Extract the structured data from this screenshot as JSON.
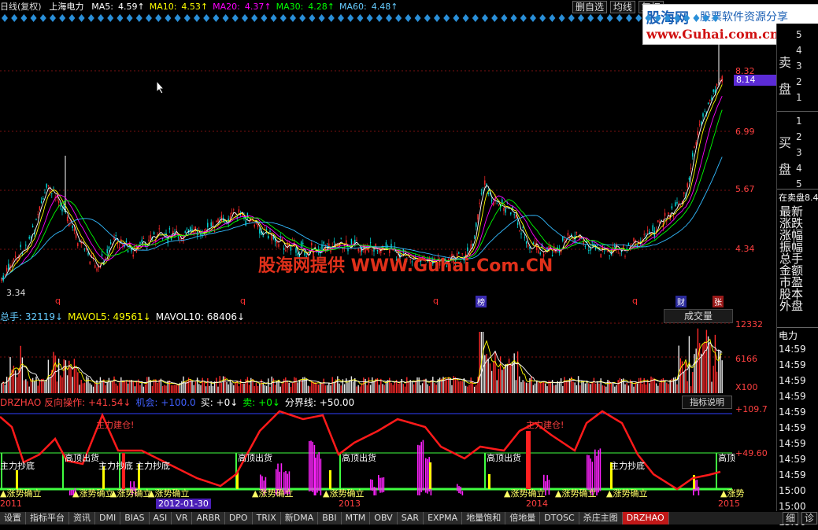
{
  "header": {
    "chart_mode": "日线(复权)",
    "stock_name": "上海电力",
    "ma": [
      {
        "label": "MA5:",
        "value": "4.59↑",
        "color": "#ffffff"
      },
      {
        "label": "MA10:",
        "value": "4.53↑",
        "color": "#ffff00"
      },
      {
        "label": "MA20:",
        "value": "4.37↑",
        "color": "#ff00ff"
      },
      {
        "label": "MA30:",
        "value": "4.28↑",
        "color": "#00ff00"
      },
      {
        "label": "MA60:",
        "value": "4.48↑",
        "color": "#66ccff"
      }
    ],
    "buttons": [
      "删自选",
      "均线",
      "复权"
    ]
  },
  "watermark": {
    "brand": "股海网",
    "slogan": "股票软件资源分享",
    "url": "www.Guhai.com.cn"
  },
  "center_watermark": "股海网提供 WWW.Guhai.Com.CN",
  "price_axis": {
    "labels": [
      "8.32",
      "8.14",
      "6.99",
      "5.67",
      "4.34"
    ],
    "current": "8.14",
    "low_label": "3.34"
  },
  "markers": [
    {
      "text": "q",
      "color": "#ff3030"
    },
    {
      "text": "q",
      "color": "#ff3030"
    },
    {
      "text": "q",
      "color": "#ff3030"
    },
    {
      "text": "榜",
      "color": "#ffffff"
    },
    {
      "text": "q",
      "color": "#ff3030"
    },
    {
      "text": "财",
      "color": "#ffffff"
    },
    {
      "text": "张",
      "color": "#ffffff"
    }
  ],
  "order_book": {
    "sell_label": [
      "卖",
      "盘"
    ],
    "sell_levels": [
      "5",
      "4",
      "3",
      "2",
      "1"
    ],
    "buy_label": [
      "买",
      "盘"
    ],
    "buy_levels": [
      "1",
      "2",
      "3",
      "4",
      "5"
    ],
    "selling_text": "在卖盘8.4",
    "menu": [
      "最新",
      "涨跌",
      "涨幅",
      "振幅",
      "总手",
      "金额",
      "市盈",
      "股本",
      "外盘"
    ]
  },
  "right_panel": {
    "stock_short": "电力",
    "times": [
      "14:59",
      "14:59",
      "14:59",
      "14:59",
      "14:59",
      "14:59",
      "14:59",
      "14:59",
      "14:59",
      "15:00",
      "15:00",
      "15:00"
    ],
    "buttons": [
      "细",
      "诊"
    ]
  },
  "volume": {
    "header": [
      {
        "text": "总手: 32119↓",
        "color": "#66ccff"
      },
      {
        "text": "MAVOL5: 49561↓",
        "color": "#ffff00"
      },
      {
        "text": "MAVOL10: 68406↓",
        "color": "#ffffff"
      }
    ],
    "selector": "成交量",
    "axis": [
      "12332",
      "6166",
      "X100"
    ]
  },
  "indicator": {
    "header": [
      {
        "text": "DRZHAO 反向操作: +41.54↓",
        "color": "#ff4040"
      },
      {
        "text": "机会: +100.0",
        "color": "#4060ff"
      },
      {
        "text": "买: +0↓",
        "color": "#ffffff"
      },
      {
        "text": "卖: +0↓",
        "color": "#00ff00"
      },
      {
        "text": "分界线: +50.00",
        "color": "#ffffff"
      }
    ],
    "help_button": "指标说明",
    "axis": [
      "+109.7",
      "+49.60"
    ],
    "top_labels": [
      "主力建仓!",
      "主力建仓!"
    ],
    "zone_labels": [
      "主力抄底",
      "高顶出货",
      "主力抄底",
      "主力抄底",
      "高顶出货",
      "高顶出货",
      "高顶出货",
      "主力抄底",
      "主力抄底",
      "高顶"
    ],
    "bottom_labels": [
      "涨势确立",
      "涨势确立",
      "涨势确立",
      "涨势确立",
      "涨势确立",
      "涨势确立",
      "涨势确立",
      "涨势确立",
      "涨势确立",
      "涨势"
    ]
  },
  "dates": {
    "labels": [
      "2011",
      "2013",
      "2014",
      "2015"
    ],
    "cursor": "2012-01-30"
  },
  "tabs": [
    "设置",
    "指标平台",
    "资讯",
    "DMI",
    "BIAS",
    "ASI",
    "VR",
    "ARBR",
    "DPO",
    "TRIX",
    "新DMA",
    "BBI",
    "MTM",
    "OBV",
    "SAR",
    "EXPMA",
    "地量饱和",
    "倍地量",
    "DTOSC",
    "杀庄主图",
    "DRZHAO"
  ],
  "active_tab": "DRZHAO",
  "colors": {
    "up": "#ff2a2a",
    "down": "#00e0e0",
    "ma5": "#ffffff",
    "ma10": "#ffff00",
    "ma20": "#ff00ff",
    "ma30": "#00ff00",
    "ma60": "#33bbff",
    "grid": "#7a1010",
    "accent": "#5b2bd6"
  }
}
